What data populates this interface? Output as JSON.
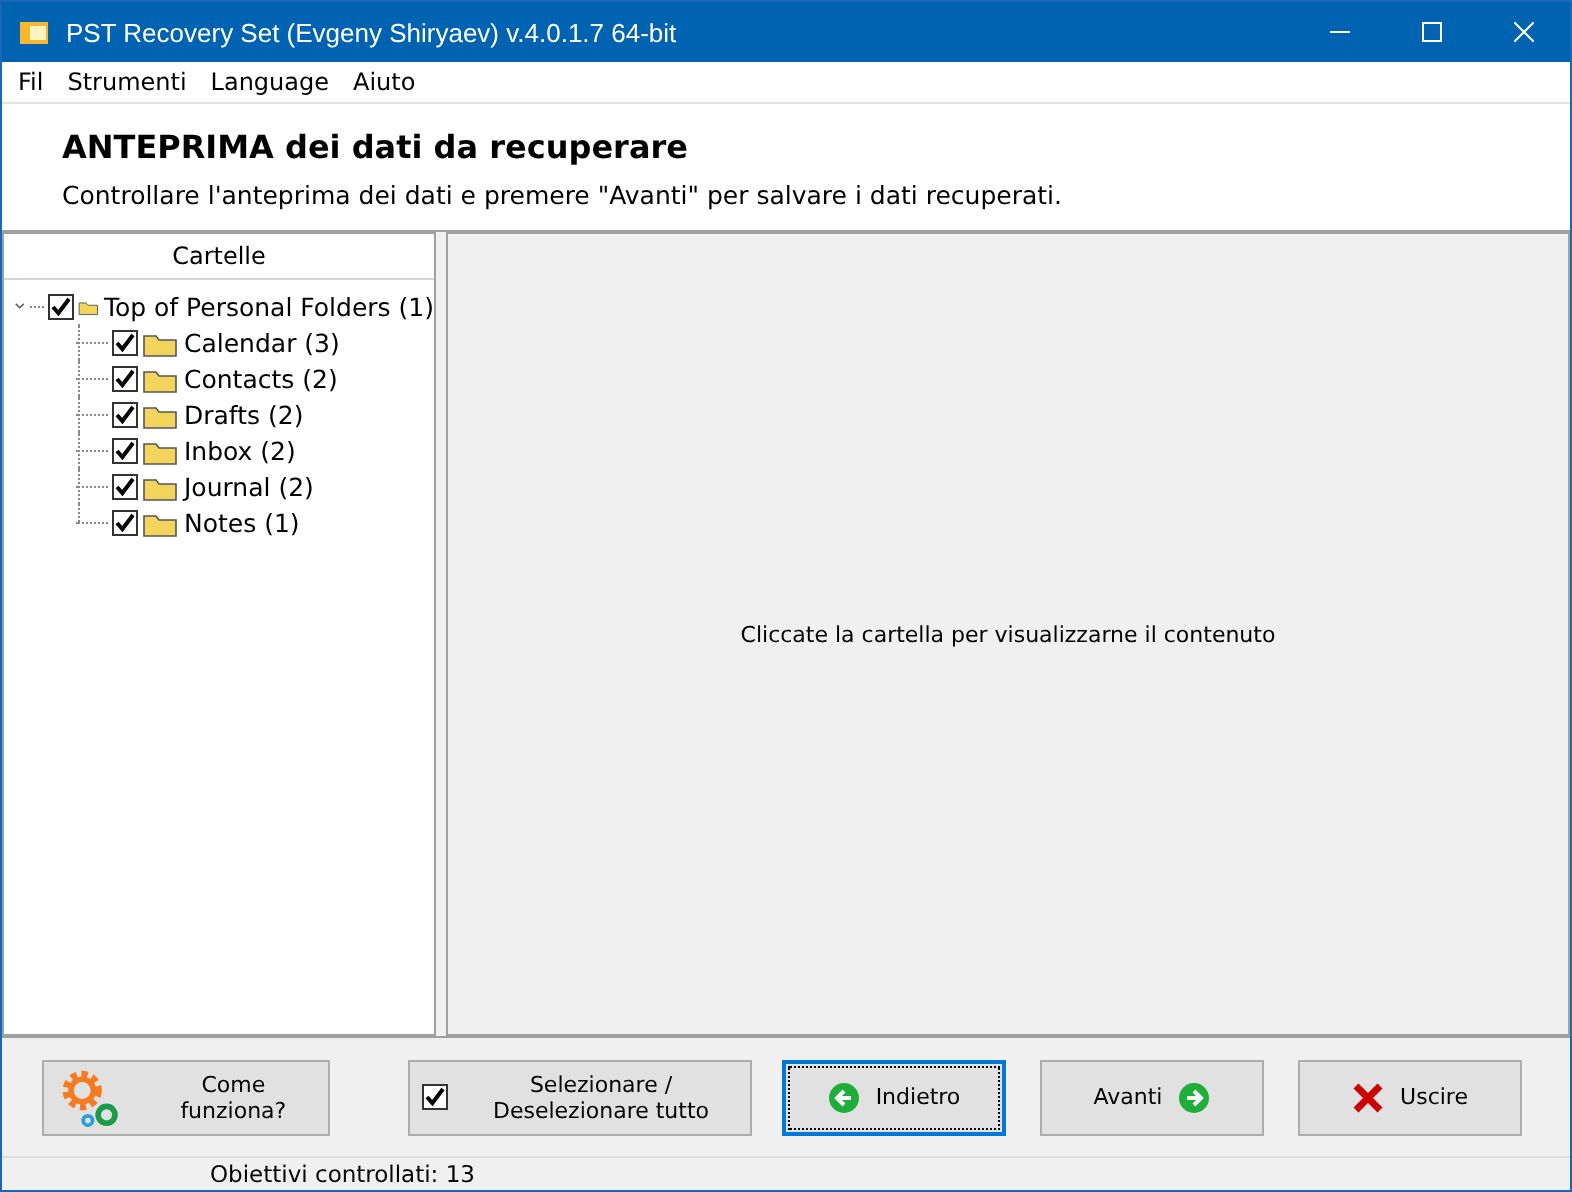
{
  "window": {
    "title": "PST Recovery Set (Evgeny Shiryaev) v.4.0.1.7 64-bit"
  },
  "menu": [
    "Fil",
    "Strumenti",
    "Language",
    "Aiuto"
  ],
  "header": {
    "title": "ANTEPRIMA dei dati da recuperare",
    "subtitle": "Controllare l'anteprima dei dati e premere \"Avanti\" per salvare i dati recuperati."
  },
  "tree": {
    "heading": "Cartelle",
    "items": [
      {
        "label": "Top of Personal Folders (1)",
        "checked": true,
        "expanded": true,
        "children": [
          {
            "label": "Calendar (3)",
            "checked": true
          },
          {
            "label": "Contacts (2)",
            "checked": true
          },
          {
            "label": "Drafts (2)",
            "checked": true
          },
          {
            "label": "Inbox (2)",
            "checked": true
          },
          {
            "label": "Journal (2)",
            "checked": true
          },
          {
            "label": "Notes (1)",
            "checked": true
          }
        ]
      }
    ]
  },
  "preview": {
    "message": "Cliccate la cartella per visualizzarne il contenuto"
  },
  "buttons": [
    {
      "kind": "help",
      "label": "Come funziona?",
      "focused": false
    },
    {
      "kind": "toggle",
      "label": "Selezionare / Deselezionare tutto",
      "checked": true,
      "focused": false
    },
    {
      "kind": "back",
      "label": "Indietro",
      "focused": true
    },
    {
      "kind": "next",
      "label": "Avanti",
      "focused": false
    },
    {
      "kind": "exit",
      "label": "Uscire",
      "focused": false
    }
  ],
  "status_bar": {
    "text": "Obiettivi controllati: 13"
  }
}
